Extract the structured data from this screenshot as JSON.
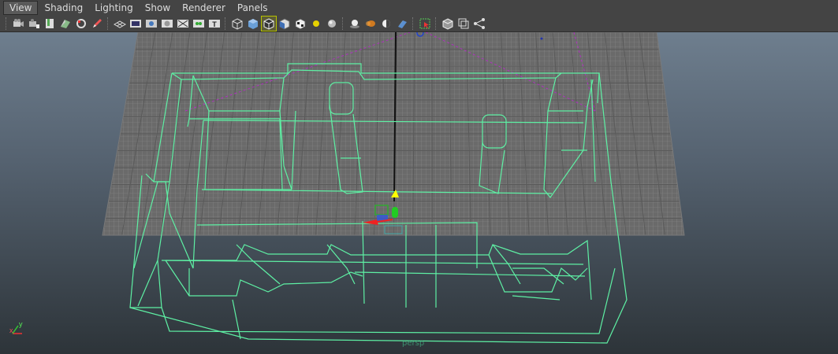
{
  "menus": [
    "View",
    "Shading",
    "Lighting",
    "Show",
    "Renderer",
    "Panels"
  ],
  "toolbar_icons": [
    "camera-select-icon",
    "camera-attributes-icon",
    "bookmark-icon",
    "image-plane-icon",
    "two-d-pan-zoom-icon",
    "grease-pencil-icon",
    "grid-icon",
    "film-gate-icon",
    "resolution-gate-icon",
    "gate-mask-icon",
    "field-chart-icon",
    "safe-action-icon",
    "safe-title-icon",
    "wireframe-icon",
    "smooth-shade-icon",
    "wireframe-on-shaded-icon",
    "default-material-icon",
    "textured-icon",
    "use-all-lights-icon",
    "shadows-icon",
    "screen-space-ao-icon",
    "motion-blur-icon",
    "multisample-aa-icon",
    "depth-of-field-icon",
    "isolate-select-icon",
    "xray-icon",
    "xray-active-components-icon",
    "xray-joints-icon"
  ],
  "viewport": {
    "camera": "persp",
    "axis_y": "y",
    "axis_x": "x"
  },
  "colors": {
    "wire": "#5ef0a4",
    "grid": "#8c8c8c",
    "menubar": "#444444"
  }
}
